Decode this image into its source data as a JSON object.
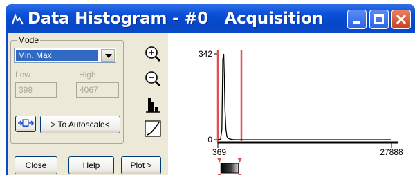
{
  "window": {
    "title": "Data Histogram - #0   Acquisition",
    "accent": "#0a4ac6",
    "titlebar_buttons": [
      "minimize-icon",
      "maximize-icon",
      "close-icon"
    ]
  },
  "controls": {
    "mode_label": "Mode",
    "mode_value": "Min. Max",
    "low_label": "Low",
    "high_label": "High",
    "low_value": "398",
    "high_value": "4067",
    "autoscale_label": "> To Autoscale<",
    "close_label": "Close",
    "help_label": "Help",
    "plot_label": "Plot >",
    "side_icons": [
      "zoom-in-icon",
      "zoom-out-icon",
      "histogram-icon",
      "curve-icon"
    ]
  },
  "chart_data": {
    "type": "line",
    "x_tick_labels": [
      "369",
      "27888"
    ],
    "y_tick_labels": [
      "0",
      "342"
    ],
    "xlim": [
      369,
      27888
    ],
    "ylim": [
      0,
      342
    ],
    "marker_color": "#e05050",
    "markers_x": [
      398,
      4067
    ],
    "x": [
      369,
      800,
      1000,
      1150,
      1300,
      1400,
      1500,
      1650,
      1800,
      2100,
      2600,
      3200,
      4067,
      27888
    ],
    "y": [
      0,
      2,
      40,
      320,
      342,
      250,
      120,
      40,
      12,
      4,
      1,
      0,
      0,
      0
    ]
  }
}
